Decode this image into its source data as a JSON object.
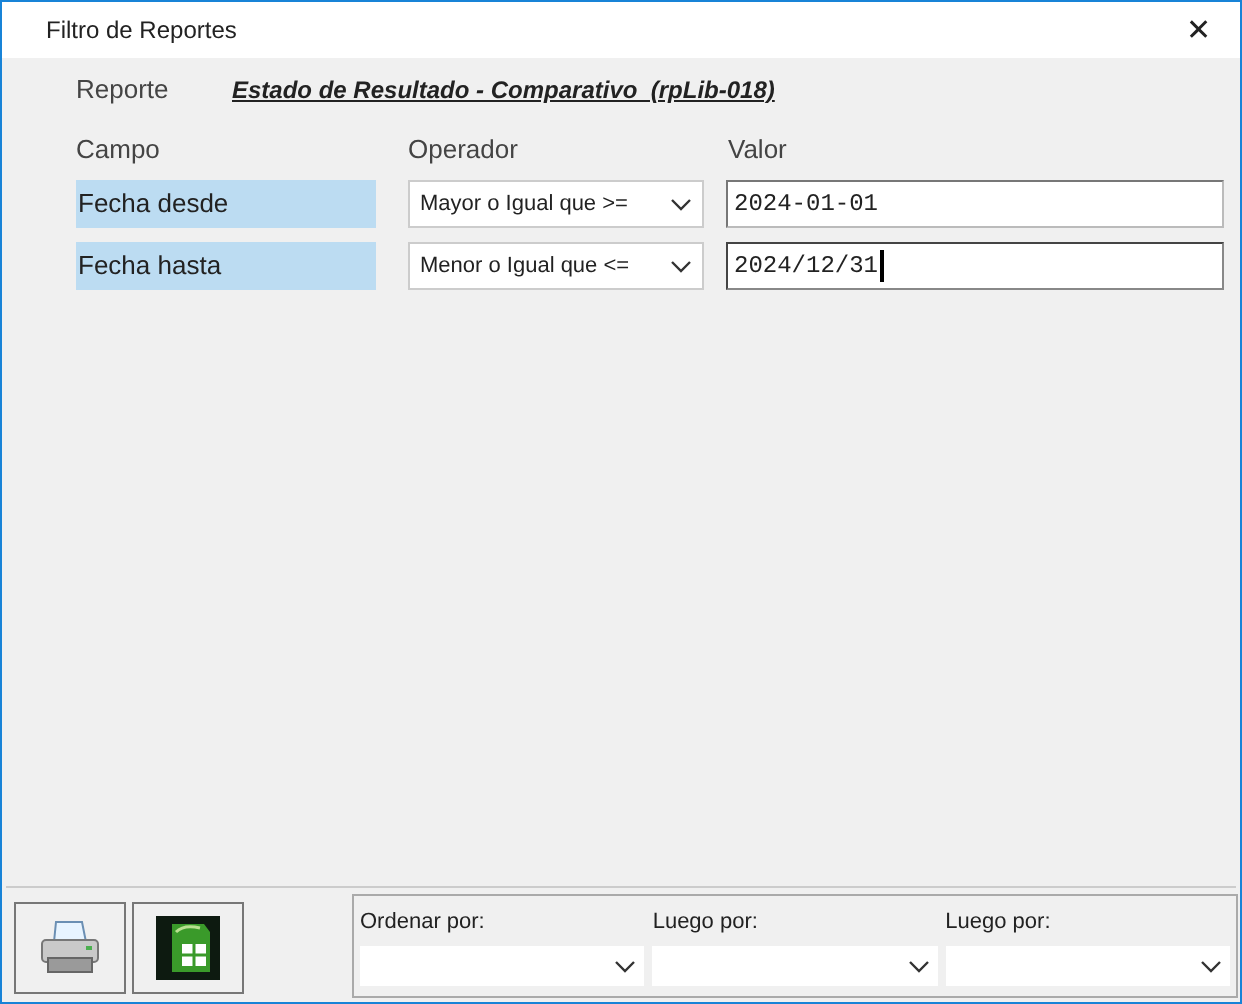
{
  "window": {
    "title": "Filtro de Reportes",
    "close": "✕"
  },
  "report": {
    "label": "Reporte",
    "name": "Estado de Resultado - Comparativo  (rpLib-018)"
  },
  "columns": [
    "Campo",
    "Operador",
    "Valor"
  ],
  "filters": [
    {
      "field": "Fecha desde",
      "operator": "Mayor o Igual que >=",
      "value": "2024-01-01",
      "focused": false
    },
    {
      "field": "Fecha hasta",
      "operator": "Menor o Igual que <=",
      "value": "2024/12/31",
      "focused": true
    }
  ],
  "sort": [
    {
      "label": "Ordenar por:"
    },
    {
      "label": "Luego por:"
    },
    {
      "label": "Luego por:"
    }
  ]
}
